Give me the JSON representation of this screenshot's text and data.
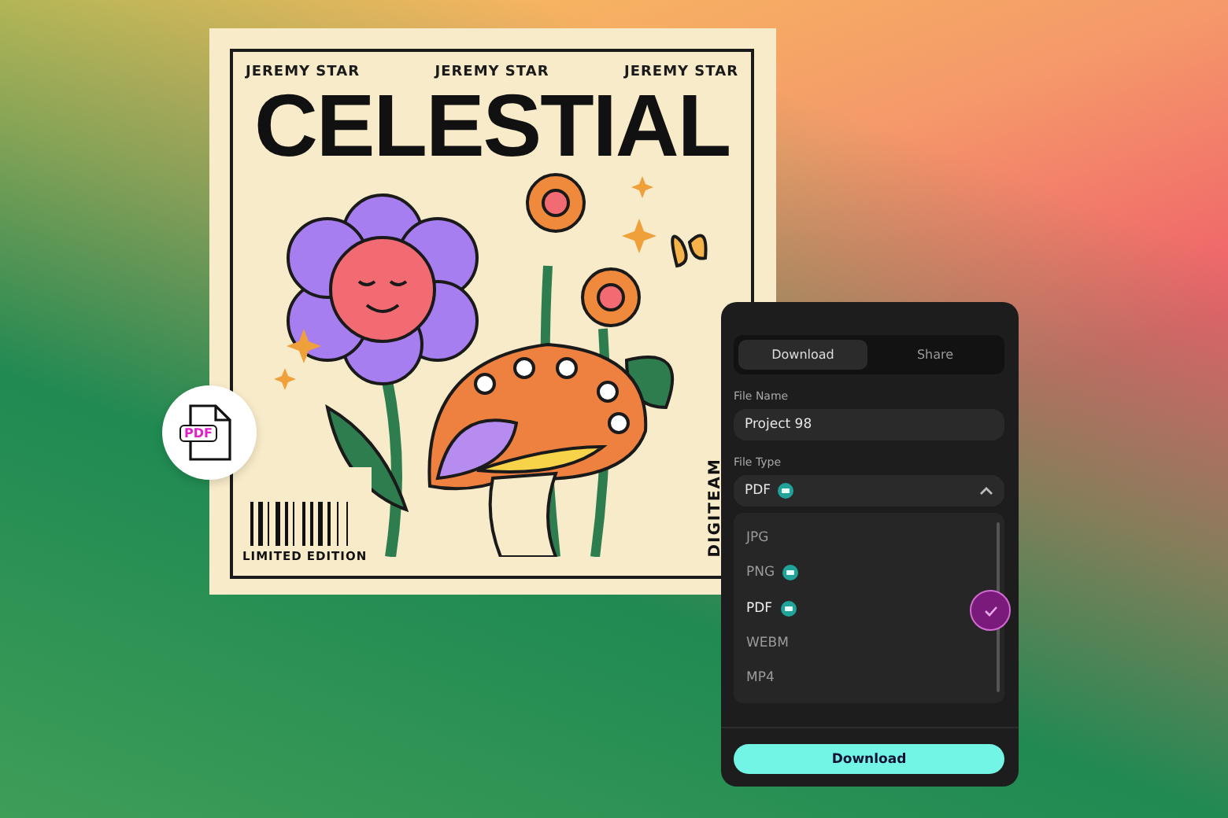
{
  "cover": {
    "artists": [
      "JEREMY STAR",
      "JEREMY STAR",
      "JEREMY STAR"
    ],
    "title": "CELESTIAL",
    "edition": "LIMITED EDITION",
    "side_label": "DIGITEAM"
  },
  "file_badge": {
    "label": "PDF"
  },
  "panel": {
    "tabs": [
      {
        "label": "Download",
        "selected": true
      },
      {
        "label": "Share",
        "selected": false
      }
    ],
    "file_name": {
      "label": "File Name",
      "value": "Project 98"
    },
    "file_type": {
      "label": "File Type",
      "value": "PDF",
      "premium": true,
      "expanded": true
    },
    "options": [
      {
        "label": "JPG",
        "premium": false,
        "selected": false
      },
      {
        "label": "PNG",
        "premium": true,
        "selected": false
      },
      {
        "label": "PDF",
        "premium": true,
        "selected": true
      },
      {
        "label": "WEBM",
        "premium": false,
        "selected": false
      },
      {
        "label": "MP4",
        "premium": false,
        "selected": false
      }
    ],
    "button": "Download"
  }
}
